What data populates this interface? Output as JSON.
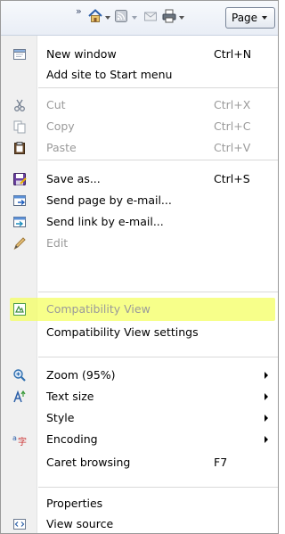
{
  "toolbar": {
    "chevron": "»",
    "items": [
      {
        "name": "home-icon"
      },
      {
        "name": "feeds-icon"
      },
      {
        "name": "read-mail-icon"
      },
      {
        "name": "print-icon"
      }
    ],
    "page_button_label": "Page"
  },
  "menu": {
    "items": [
      {
        "label": "New window",
        "shortcut": "Ctrl+N",
        "icon": "new-window-icon",
        "enabled": true
      },
      {
        "label": "Add site to Start menu",
        "shortcut": "",
        "icon": "",
        "enabled": true
      },
      {
        "label": "Cut",
        "shortcut": "Ctrl+X",
        "icon": "cut-icon",
        "enabled": false
      },
      {
        "label": "Copy",
        "shortcut": "Ctrl+C",
        "icon": "copy-icon",
        "enabled": false
      },
      {
        "label": "Paste",
        "shortcut": "Ctrl+V",
        "icon": "paste-icon",
        "enabled": false
      },
      {
        "label": "Save as...",
        "shortcut": "Ctrl+S",
        "icon": "save-as-icon",
        "enabled": true
      },
      {
        "label": "Send page by e-mail...",
        "shortcut": "",
        "icon": "send-page-email-icon",
        "enabled": true
      },
      {
        "label": "Send link by e-mail...",
        "shortcut": "",
        "icon": "send-link-email-icon",
        "enabled": true
      },
      {
        "label": "Edit",
        "shortcut": "",
        "icon": "edit-pencil-icon",
        "enabled": false
      },
      {
        "label": "Compatibility View",
        "shortcut": "",
        "icon": "compatibility-view-icon",
        "enabled": false,
        "highlighted": true
      },
      {
        "label": "Compatibility View settings",
        "shortcut": "",
        "icon": "",
        "enabled": true
      },
      {
        "label": "Zoom (95%)",
        "shortcut": "",
        "icon": "zoom-icon",
        "enabled": true,
        "submenu": true
      },
      {
        "label": "Text size",
        "shortcut": "",
        "icon": "text-size-icon",
        "enabled": true,
        "submenu": true
      },
      {
        "label": "Style",
        "shortcut": "",
        "icon": "",
        "enabled": true,
        "submenu": true
      },
      {
        "label": "Encoding",
        "shortcut": "",
        "icon": "encoding-icon",
        "enabled": true,
        "submenu": true
      },
      {
        "label": "Caret browsing",
        "shortcut": "F7",
        "icon": "",
        "enabled": true
      },
      {
        "label": "Properties",
        "shortcut": "",
        "icon": "",
        "enabled": true
      },
      {
        "label": "View source",
        "shortcut": "",
        "icon": "view-source-icon",
        "enabled": true
      }
    ]
  },
  "colors": {
    "highlight": "#f4ff63",
    "disabled_text": "#9a9a9a",
    "gutter": "#f0f0f0"
  }
}
